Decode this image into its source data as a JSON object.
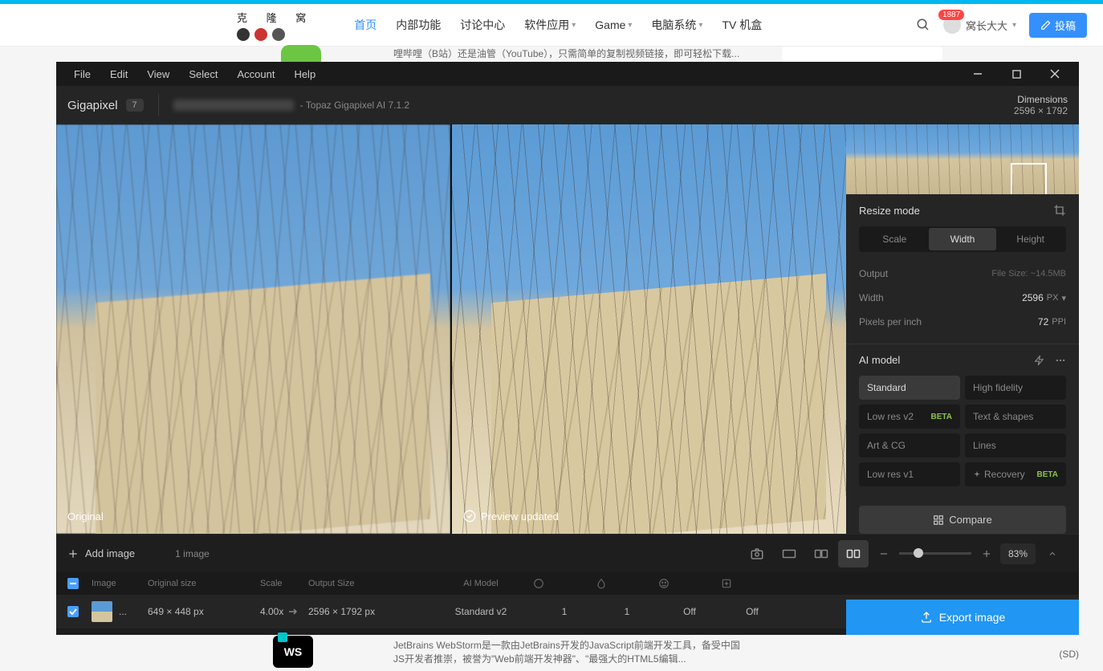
{
  "site": {
    "logo_text": "克 隆 窝",
    "nav": {
      "home": "首页",
      "features": "内部功能",
      "discuss": "讨论中心",
      "software": "软件应用",
      "game": "Game",
      "pc": "电脑系统",
      "tv": "TV 机盒"
    },
    "user": {
      "name": "窝长大大",
      "badge": "1887"
    },
    "post_btn": "投稿",
    "desc_top": "哩哔哩（B站）还是油管（YouTube），只需简单的复制视频链接，即可轻松下载...",
    "desc_bottom": "JetBrains WebStorm是一款由JetBrains开发的JavaScript前端开发工具，备受中国JS开发者推崇，被誉为\"Web前端开发神器\"、\"最强大的HTML5编辑...",
    "ws_label": "WS",
    "side_sd": "(SD)"
  },
  "app": {
    "menu": {
      "file": "File",
      "edit": "Edit",
      "view": "View",
      "select": "Select",
      "account": "Account",
      "help": "Help"
    },
    "name": "Gigapixel",
    "badge": "7",
    "subtitle": "- Topaz Gigapixel AI 7.1.2",
    "dimensions": {
      "label": "Dimensions",
      "value": "2596 × 1792"
    },
    "preview": {
      "original": "Original",
      "updated": "Preview updated"
    },
    "resize": {
      "title": "Resize mode",
      "tabs": {
        "scale": "Scale",
        "width": "Width",
        "height": "Height"
      },
      "output": "Output",
      "filesize": "File Size: ~14.5MB",
      "width_label": "Width",
      "width_value": "2596",
      "width_unit": "PX",
      "ppi_label": "Pixels per inch",
      "ppi_value": "72",
      "ppi_unit": "PPI"
    },
    "model": {
      "title": "AI model",
      "standard": "Standard",
      "high_fidelity": "High fidelity",
      "low_res_v2": "Low res v2",
      "text_shapes": "Text & shapes",
      "art_cg": "Art & CG",
      "lines": "Lines",
      "low_res_v1": "Low res v1",
      "recovery": "Recovery",
      "beta": "BETA"
    },
    "compare": "Compare",
    "export": "Export image",
    "toolbar": {
      "add": "Add image",
      "count": "1 image",
      "zoom": "83%"
    },
    "table": {
      "headers": {
        "image": "Image",
        "original": "Original size",
        "scale": "Scale",
        "output": "Output Size",
        "model": "AI Model"
      },
      "row": {
        "name": "...",
        "original": "649 × 448 px",
        "scale": "4.00x",
        "output": "2596 × 1792 px",
        "model": "Standard v2",
        "v1": "1",
        "v2": "1",
        "v3": "Off",
        "v4": "Off"
      }
    }
  }
}
